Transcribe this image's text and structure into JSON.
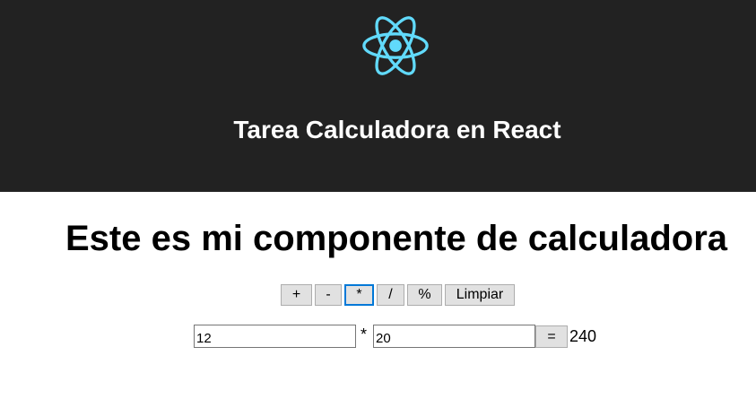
{
  "header": {
    "logo_icon": "react-atom-icon",
    "logo_color": "#61dafb",
    "background": "#222222",
    "title": "Tarea Calculadora en React"
  },
  "calculator": {
    "heading": "Este es mi componente de calculadora",
    "operations": [
      {
        "label": "+"
      },
      {
        "label": "-"
      },
      {
        "label": "*"
      },
      {
        "label": "/"
      },
      {
        "label": "%"
      },
      {
        "label": "Limpiar"
      }
    ],
    "selected_operation": "*",
    "operand_a": "12",
    "operand_b": "20",
    "operator_display": "*",
    "equals_label": "=",
    "result": "240",
    "active_border_color": "#0078d7"
  }
}
